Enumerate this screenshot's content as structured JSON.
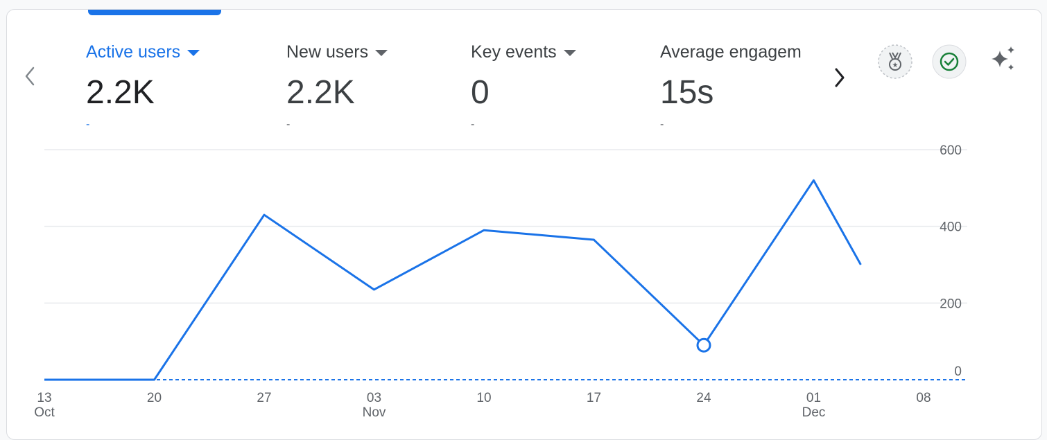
{
  "colors": {
    "accent": "#1a73e8",
    "line": "#1a73e8",
    "grid": "#e8eaed",
    "text_secondary": "#5f6368",
    "success": "#188038"
  },
  "nav": {
    "prev_icon": "chevron-left-icon",
    "next_icon": "chevron-right-icon"
  },
  "metrics": [
    {
      "label": "Active users",
      "value": "2.2K",
      "change": "-",
      "active": true
    },
    {
      "label": "New users",
      "value": "2.2K",
      "change": "-",
      "active": false
    },
    {
      "label": "Key events",
      "value": "0",
      "change": "-",
      "active": false
    },
    {
      "label": "Average engagem",
      "value": "15s",
      "change": "-",
      "active": false
    }
  ],
  "actions": {
    "badge_icon": "medal-badge-icon",
    "check_icon": "check-circle-icon",
    "insights_icon": "sparkle-icon"
  },
  "chart_data": {
    "type": "line",
    "series": [
      {
        "values": [
          0,
          0,
          430,
          235,
          390,
          365,
          90,
          520,
          300
        ]
      }
    ],
    "x_positions": [
      13,
      20,
      27,
      34,
      41,
      48,
      55,
      62,
      65
    ],
    "x_ticks": [
      {
        "day": "13",
        "month": "Oct",
        "pos": 13
      },
      {
        "day": "20",
        "month": "",
        "pos": 20
      },
      {
        "day": "27",
        "month": "",
        "pos": 27
      },
      {
        "day": "03",
        "month": "Nov",
        "pos": 34
      },
      {
        "day": "10",
        "month": "",
        "pos": 41
      },
      {
        "day": "17",
        "month": "",
        "pos": 48
      },
      {
        "day": "24",
        "month": "",
        "pos": 55
      },
      {
        "day": "01",
        "month": "Dec",
        "pos": 62
      },
      {
        "day": "08",
        "month": "",
        "pos": 69
      }
    ],
    "y_ticks": [
      0,
      200,
      400,
      600
    ],
    "ylim": [
      0,
      600
    ],
    "highlight_index": 6,
    "grid": true,
    "y_axis_position": "right"
  }
}
